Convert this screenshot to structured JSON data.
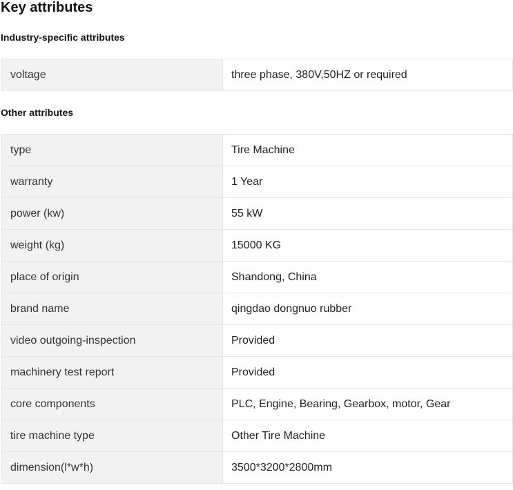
{
  "title": "Key attributes",
  "industry": {
    "heading": "Industry-specific attributes",
    "rows": [
      {
        "name": "voltage",
        "value": "three phase, 380V,50HZ or required"
      }
    ]
  },
  "other": {
    "heading": "Other attributes",
    "rows": [
      {
        "name": "type",
        "value": "Tire Machine"
      },
      {
        "name": "warranty",
        "value": "1 Year"
      },
      {
        "name": "power (kw)",
        "value": "55 kW"
      },
      {
        "name": "weight (kg)",
        "value": "15000 KG"
      },
      {
        "name": "place of origin",
        "value": "Shandong, China"
      },
      {
        "name": "brand name",
        "value": "qingdao dongnuo rubber"
      },
      {
        "name": "video outgoing-inspection",
        "value": "Provided"
      },
      {
        "name": "machinery test report",
        "value": "Provided"
      },
      {
        "name": "core components",
        "value": "PLC, Engine, Bearing, Gearbox, motor, Gear"
      },
      {
        "name": "tire machine type",
        "value": "Other Tire Machine"
      },
      {
        "name": "dimension(l*w*h)",
        "value": "3500*3200*2800mm"
      }
    ]
  }
}
